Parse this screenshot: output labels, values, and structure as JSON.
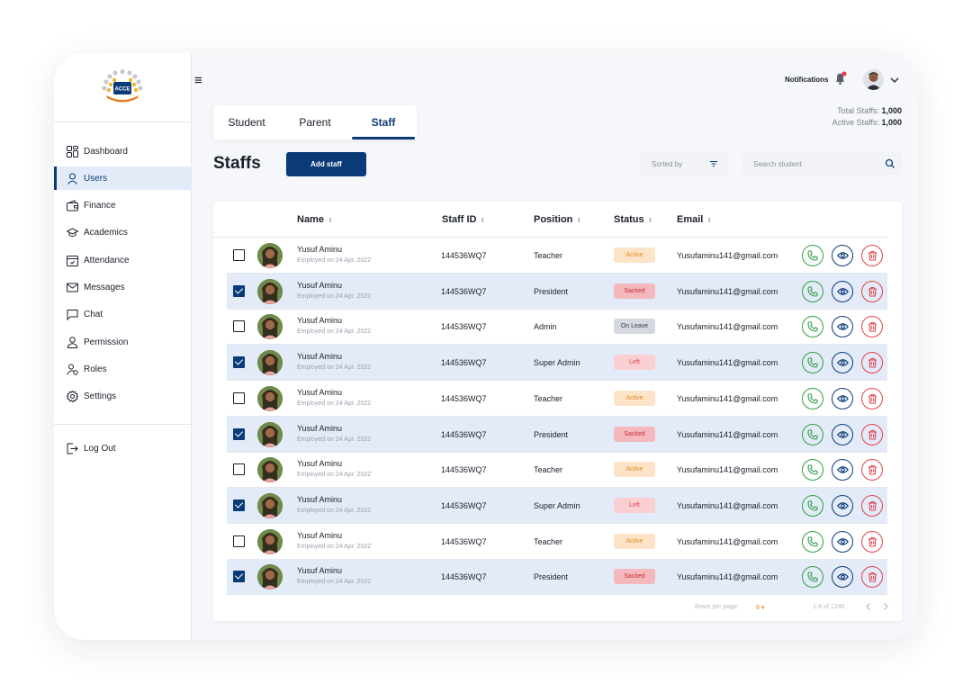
{
  "brand": {
    "logo_text": "ACCE",
    "accent": "#0a3b78"
  },
  "sidebar": {
    "items": [
      {
        "label": "Dashboard",
        "icon": "dashboard-icon"
      },
      {
        "label": "Users",
        "icon": "user-icon",
        "active": true
      },
      {
        "label": "Finance",
        "icon": "wallet-icon"
      },
      {
        "label": "Academics",
        "icon": "graduation-cap-icon"
      },
      {
        "label": "Attendance",
        "icon": "calendar-check-icon"
      },
      {
        "label": "Messages",
        "icon": "mail-icon"
      },
      {
        "label": "Chat",
        "icon": "chat-bubble-icon"
      },
      {
        "label": "Permission",
        "icon": "person-icon"
      },
      {
        "label": "Roles",
        "icon": "users-gear-icon"
      },
      {
        "label": "Settings",
        "icon": "gear-icon"
      }
    ],
    "logout": {
      "label": "Log Out",
      "icon": "logout-icon"
    }
  },
  "header": {
    "notifications_label": "Notifications",
    "totals": {
      "total_label": "Total Staffs: ",
      "total_value": "1,000",
      "active_label": "Active Staffs: ",
      "active_value": "1,000"
    }
  },
  "tabs": [
    {
      "label": "Student"
    },
    {
      "label": "Parent"
    },
    {
      "label": "Staff",
      "active": true
    }
  ],
  "page_title": "Staffs",
  "add_button": "Add staff",
  "sort_label": "Sorted by",
  "search_placeholder": "Search student",
  "table": {
    "headers": [
      "Name",
      "Staff ID",
      "Position",
      "Status",
      "Email"
    ],
    "sort_glyph": "⇕",
    "rows": [
      {
        "selected": false,
        "name": "Yusuf Aminu",
        "employed": "Employed on 24 Apr. 2022",
        "staff_id": "144536WQ7",
        "position": "Teacher",
        "status": "Active",
        "email": "Yusufaminu141@gmail.com"
      },
      {
        "selected": true,
        "name": "Yusuf Aminu",
        "employed": "Employed on 24 Apr. 2022",
        "staff_id": "144536WQ7",
        "position": "President",
        "status": "Sacked",
        "email": "Yusufaminu141@gmail.com"
      },
      {
        "selected": false,
        "name": "Yusuf Aminu",
        "employed": "Employed on 24 Apr. 2022",
        "staff_id": "144536WQ7",
        "position": "Admin",
        "status": "On Leave",
        "email": "Yusufaminu141@gmail.com"
      },
      {
        "selected": true,
        "name": "Yusuf Aminu",
        "employed": "Employed on 24 Apr. 2022",
        "staff_id": "144536WQ7",
        "position": "Super Admin",
        "status": "Left",
        "email": "Yusufaminu141@gmail.com"
      },
      {
        "selected": false,
        "name": "Yusuf Aminu",
        "employed": "Employed on 24 Apr. 2022",
        "staff_id": "144536WQ7",
        "position": "Teacher",
        "status": "Active",
        "email": "Yusufaminu141@gmail.com"
      },
      {
        "selected": true,
        "name": "Yusuf Aminu",
        "employed": "Employed on 24 Apr. 2022",
        "staff_id": "144536WQ7",
        "position": "President",
        "status": "Sacked",
        "email": "Yusufaminu141@gmail.com"
      },
      {
        "selected": false,
        "name": "Yusuf Aminu",
        "employed": "Employed on 24 Apr. 2022",
        "staff_id": "144536WQ7",
        "position": "Teacher",
        "status": "Active",
        "email": "Yusufaminu141@gmail.com"
      },
      {
        "selected": true,
        "name": "Yusuf Aminu",
        "employed": "Employed on 24 Apr. 2022",
        "staff_id": "144536WQ7",
        "position": "Super Admin",
        "status": "Left",
        "email": "Yusufaminu141@gmail.com"
      },
      {
        "selected": false,
        "name": "Yusuf Aminu",
        "employed": "Employed on 24 Apr. 2022",
        "staff_id": "144536WQ7",
        "position": "Teacher",
        "status": "Active",
        "email": "Yusufaminu141@gmail.com"
      },
      {
        "selected": true,
        "name": "Yusuf Aminu",
        "employed": "Employed on 24 Apr. 2022",
        "staff_id": "144536WQ7",
        "position": "President",
        "status": "Sacked",
        "email": "Yusufaminu141@gmail.com"
      }
    ],
    "status_colors": {
      "Active": "#e88a1f",
      "Sacked": "#c92a34",
      "On Leave": "#3a3f4a",
      "Left": "#e0434d"
    },
    "action_icons": [
      "phone-icon",
      "eye-icon",
      "trash-icon"
    ]
  },
  "footer": {
    "rows_per_page_label": "Rows per page:",
    "rows_per_page_value": "8",
    "range": "1-8 of 1240"
  }
}
